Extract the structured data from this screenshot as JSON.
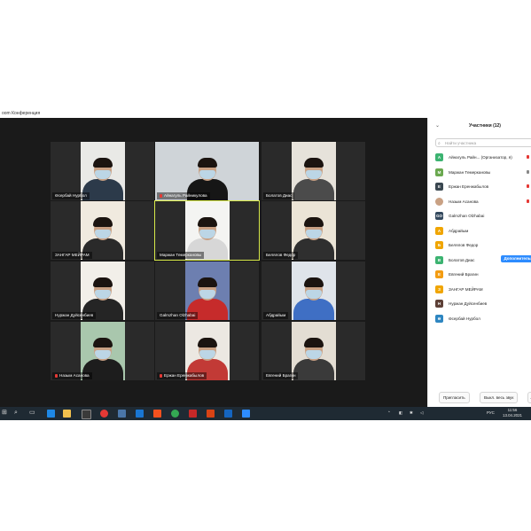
{
  "window": {
    "title": "oom Конференция"
  },
  "tiles": [
    {
      "name": "Өсербай Нурбол",
      "muted": false,
      "bg": "#e9e9e6",
      "shirt": "#2c3a4a"
    },
    {
      "name": "Айнагуль Райникулова",
      "muted": true,
      "bg": "#cfd4d8",
      "shirt": "#161616",
      "hair": "#1b1410"
    },
    {
      "name": "Болатов Диас",
      "muted": false,
      "bg": "#e6e2da",
      "shirt": "#4b4b4b"
    },
    {
      "name": "ЗАНГАР МЕЙРАМ",
      "muted": false,
      "bg": "#f0eadf",
      "shirt": "#2a2a2a"
    },
    {
      "name": "Маржан Темеркановы",
      "muted": false,
      "bg": "#f4f4f2",
      "shirt": "#d7d7d7",
      "active": true
    },
    {
      "name": "Белялов Федор",
      "muted": false,
      "bg": "#ebe4d6",
      "shirt": "#2f2f2f"
    },
    {
      "name": "Нуржан Дуйсенбиев",
      "muted": false,
      "bg": "#f2efe9",
      "shirt": "#252525"
    },
    {
      "name": "Galmzhan Olzhabai",
      "muted": false,
      "bg": "#6d7fb0",
      "shirt": "#c62b2b"
    },
    {
      "name": "Абдрайым",
      "muted": false,
      "bg": "#dfe4ea",
      "shirt": "#3f6fc4"
    },
    {
      "name": "Назым Асанова",
      "muted": true,
      "bg": "#a9c7ad",
      "shirt": "#1d1d1d"
    },
    {
      "name": "Ержан Еренжабылов",
      "muted": true,
      "bg": "#ece8e2",
      "shirt": "#c23a36"
    },
    {
      "name": "Евгений Брагин",
      "muted": false,
      "bg": "#e3ddd3",
      "shirt": "#3a3a3a"
    }
  ],
  "panel": {
    "title": "Участники (12)",
    "search_placeholder": "Найти участника",
    "more_label": "Дополнительно",
    "participants": [
      {
        "initial": "A",
        "color": "#3cb371",
        "name": "Айнагуль Райн... (Организатор, я)",
        "icon": "red"
      },
      {
        "initial": "M",
        "color": "#6aa84f",
        "name": "Маржан Темеркановы",
        "icon": "grey"
      },
      {
        "initial": "E",
        "color": "#3a4750",
        "name": "Ержан Еренжабылов",
        "icon": "red"
      },
      {
        "initial": "",
        "color": "#c9a184",
        "name": "Назым Асанова",
        "icon": "red"
      },
      {
        "initial": "GO",
        "color": "#34495e",
        "name": "Galmzhan Olzhabai",
        "icon": ""
      },
      {
        "initial": "A",
        "color": "#f0a500",
        "name": "Абдрайым",
        "icon": ""
      },
      {
        "initial": "Б",
        "color": "#f0a500",
        "name": "Белялов Федор",
        "icon": ""
      },
      {
        "initial": "B",
        "color": "#3cb371",
        "name": "Болатов Диас",
        "icon": "",
        "more": true
      },
      {
        "initial": "E",
        "color": "#f39c12",
        "name": "Евгений Брагин",
        "icon": ""
      },
      {
        "initial": "З",
        "color": "#f0a500",
        "name": "ЗАНГАР МЕЙРАМ",
        "icon": ""
      },
      {
        "initial": "H",
        "color": "#5d4037",
        "name": "Нуржан Дуйсенбиев",
        "icon": ""
      },
      {
        "initial": "Ө",
        "color": "#2e86c1",
        "name": "Өсербай Нурбол",
        "icon": ""
      }
    ],
    "invite_label": "Пригласить",
    "mute_all_label": "Выкл. весь звук",
    "more_dots": "..."
  },
  "taskbar": {
    "language": "РУС",
    "time": "11:56",
    "date": "13.04.2021"
  }
}
